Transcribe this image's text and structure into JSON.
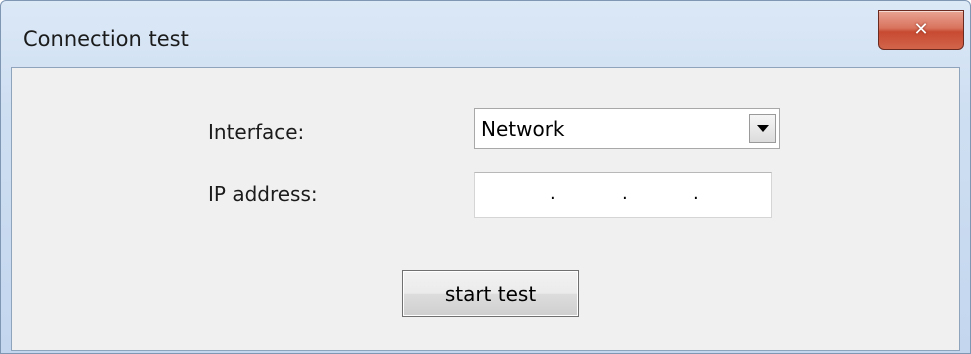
{
  "window": {
    "title": "Connection test",
    "close_icon": "close-icon"
  },
  "form": {
    "interface_label": "Interface:",
    "interface_value": "Network",
    "dropdown_icon": "chevron-down-icon",
    "ip_label": "IP address:",
    "ip_value": "",
    "ip_separators": [
      ".",
      ".",
      "."
    ]
  },
  "actions": {
    "start_label": "start test"
  }
}
